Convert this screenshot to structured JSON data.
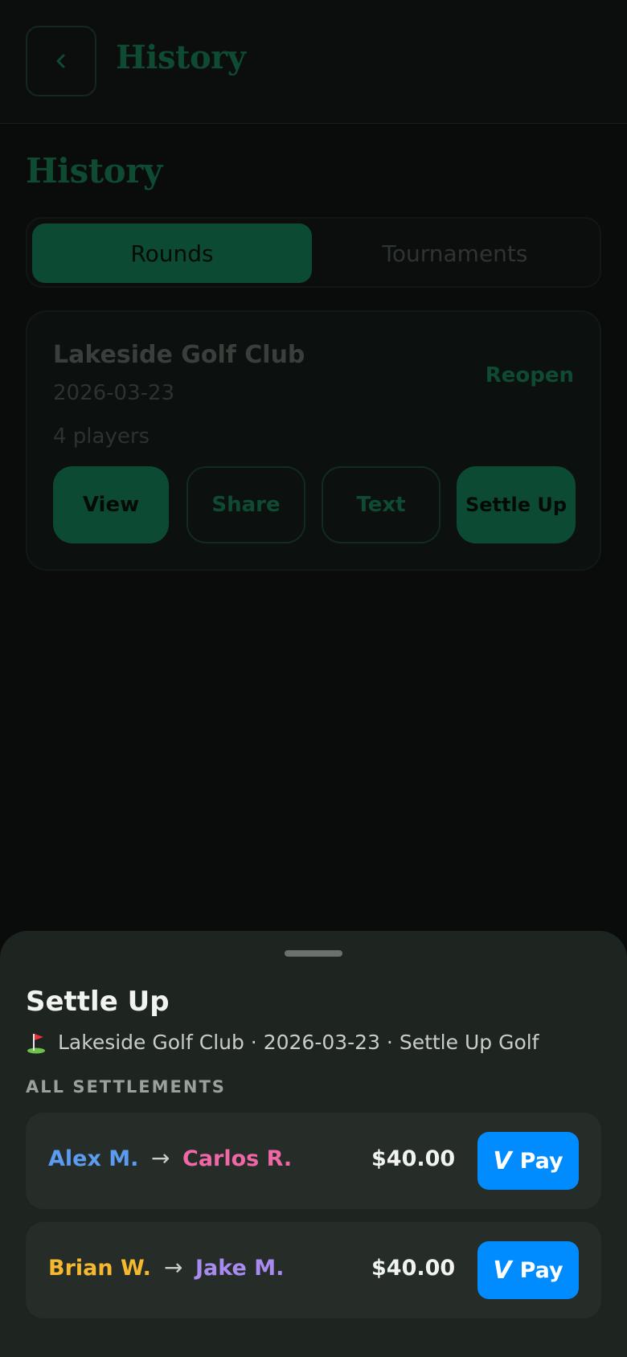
{
  "header": {
    "title": "History",
    "back_icon": "chevron-left-icon"
  },
  "page": {
    "title": "History"
  },
  "tabs": [
    {
      "label": "Rounds",
      "active": true
    },
    {
      "label": "Tournaments",
      "active": false
    }
  ],
  "round_card": {
    "course": "Lakeside Golf Club",
    "date": "2026-03-23",
    "players": "4 players",
    "reopen_label": "Reopen",
    "buttons": {
      "view": "View",
      "share": "Share",
      "text": "Text",
      "settle_up": "Settle Up"
    }
  },
  "sheet": {
    "title": "Settle Up",
    "subtitle_icon": "golf-flag-icon",
    "subtitle": "Lakeside Golf Club · 2026-03-23 · Settle Up Golf",
    "section_label": "ALL SETTLEMENTS",
    "settlements": [
      {
        "from": "Alex M.",
        "from_color": "#5b9cf0",
        "to": "Carlos R.",
        "to_color": "#f067a6",
        "amount": "$40.00",
        "pay_label": "Pay"
      },
      {
        "from": "Brian W.",
        "from_color": "#f5b82e",
        "to": "Jake M.",
        "to_color": "#a98bf0",
        "amount": "$40.00",
        "pay_label": "Pay"
      }
    ],
    "arrow": "→",
    "pay_icon": "venmo-icon",
    "pay_icon_glyph": "V"
  },
  "colors": {
    "accent": "#0c4a33",
    "pay_blue": "#008cff"
  }
}
